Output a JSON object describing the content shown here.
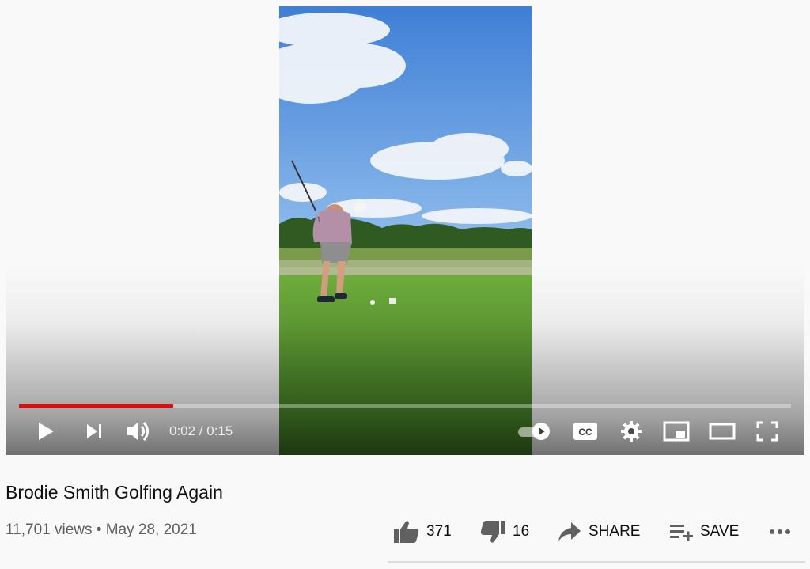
{
  "player": {
    "time_display": "0:02 / 0:15",
    "progress_fraction": 0.2,
    "progress_color": "#ff0000",
    "controls": {
      "play_icon": "play-icon",
      "next_icon": "skip-next-icon",
      "volume_icon": "volume-icon",
      "autoplay_icon": "autoplay-toggle-icon",
      "captions_icon": "cc-icon",
      "settings_icon": "gear-icon",
      "miniplayer_icon": "miniplayer-icon",
      "theater_icon": "theater-mode-icon",
      "fullscreen_icon": "fullscreen-icon"
    }
  },
  "video": {
    "title": "Brodie Smith Golfing Again",
    "views": "11,701 views",
    "separator": "•",
    "date": "May 28, 2021"
  },
  "actions": {
    "likes": "371",
    "dislikes": "16",
    "share_label": "SHARE",
    "save_label": "SAVE",
    "more_icon": "more-horizontal-icon"
  }
}
